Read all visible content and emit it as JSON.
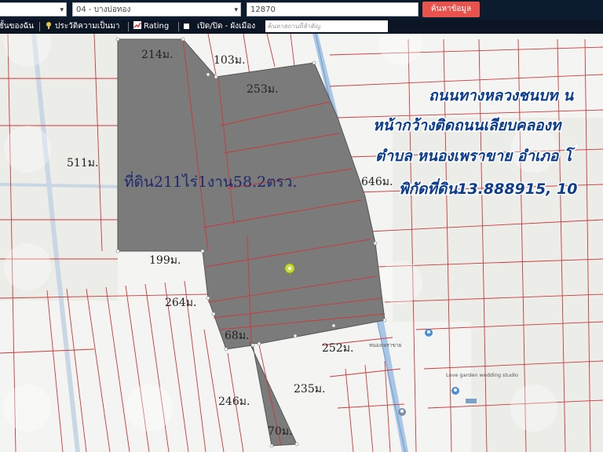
{
  "topbar": {
    "district_value": "04 - บางบ่อทอง",
    "postcode_value": "12870",
    "search_button": "ค้นหาข้อมูล"
  },
  "toolbar": {
    "item_layers": "ชั้นของฉัน",
    "item_history": "ประวัติความเป็นมา",
    "item_rating": "Rating",
    "item_toggle": "เปิด/ปิด - ผังเมือง",
    "search_placeholder": "ค้นหาสถานที่สำคัญ"
  },
  "map": {
    "area_label": "ที่ดิน211ไร่1งาน58.2ตรว.",
    "dimensions": [
      "214ม.",
      "103ม.",
      "253ม.",
      "511ม.",
      "646ม.",
      "199ม.",
      "264ม.",
      "68ม.",
      "252ม.",
      "235ม.",
      "246ม.",
      "70ม."
    ],
    "overlay_lines": [
      "ถนนทางหลวงชนบท น",
      "หน้ากว้างติดถนนเลียบคลองท",
      "ตำบล หนองเพราขาย อำเภอ โ",
      "พิกัดที่ดิน13.888915, 10"
    ],
    "poi_1": "Love garden wedding studio",
    "poi_2": "หนองเพราขาย",
    "colors": {
      "parcel_fill": "#7b7b7b",
      "boundary": "#c93a3a",
      "overlay_text": "#0b3d8f",
      "road": "#a9c6e6"
    }
  }
}
